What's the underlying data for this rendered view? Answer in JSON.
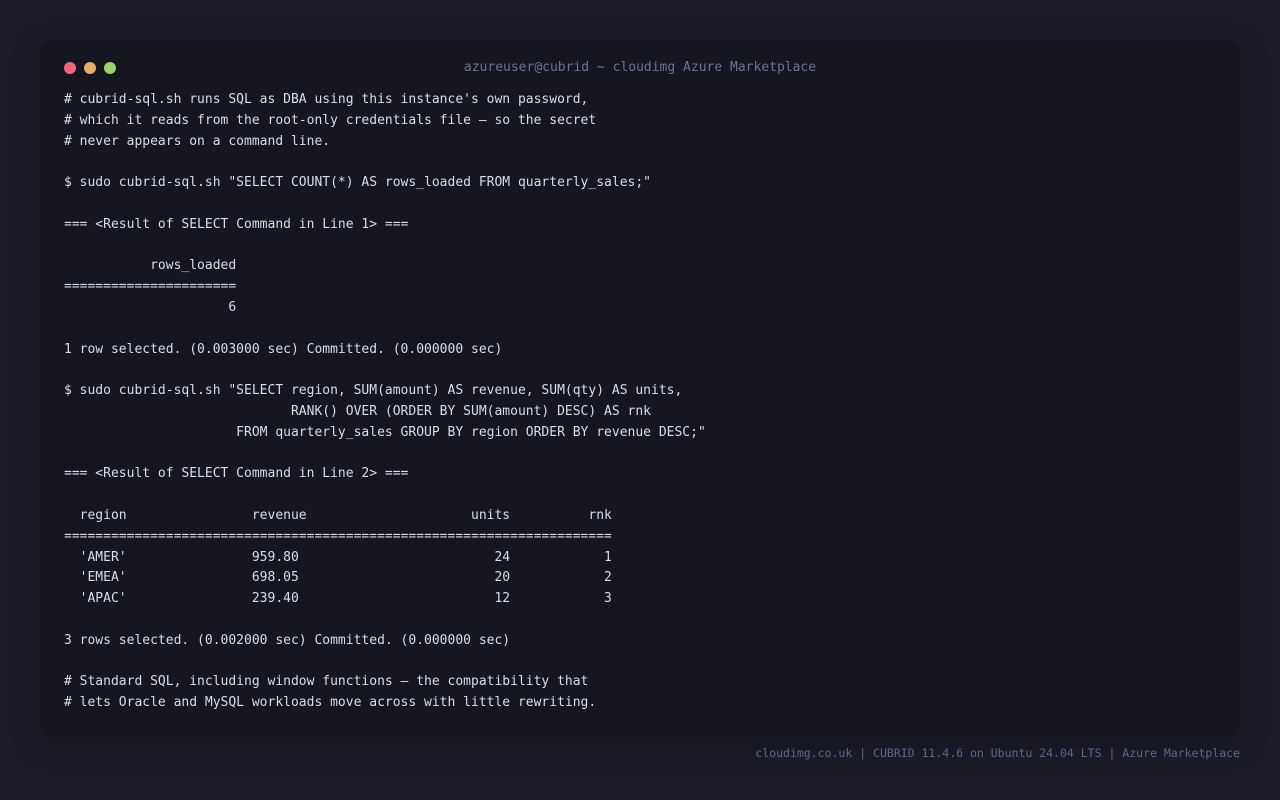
{
  "window": {
    "title": "azureuser@cubrid ~ cloudimg Azure Marketplace",
    "traffic_lights": {
      "close": "#f0677d",
      "minimize": "#e6ad6b",
      "maximize": "#9ad26d"
    }
  },
  "terminal": {
    "lines": [
      "# cubrid-sql.sh runs SQL as DBA using this instance's own password,",
      "# which it reads from the root-only credentials file — so the secret",
      "# never appears on a command line.",
      "",
      "$ sudo cubrid-sql.sh \"SELECT COUNT(*) AS rows_loaded FROM quarterly_sales;\"",
      "",
      "=== <Result of SELECT Command in Line 1> ===",
      "",
      "           rows_loaded",
      "======================",
      "                     6",
      "",
      "1 row selected. (0.003000 sec) Committed. (0.000000 sec)",
      "",
      "$ sudo cubrid-sql.sh \"SELECT region, SUM(amount) AS revenue, SUM(qty) AS units,",
      "                             RANK() OVER (ORDER BY SUM(amount) DESC) AS rnk",
      "                      FROM quarterly_sales GROUP BY region ORDER BY revenue DESC;\"",
      "",
      "=== <Result of SELECT Command in Line 2> ===",
      "",
      "  region                revenue                     units          rnk",
      "======================================================================",
      "  'AMER'                959.80                         24            1",
      "  'EMEA'                698.05                         20            2",
      "  'APAC'                239.40                         12            3",
      "",
      "3 rows selected. (0.002000 sec) Committed. (0.000000 sec)",
      "",
      "# Standard SQL, including window functions — the compatibility that",
      "# lets Oracle and MySQL workloads move across with little rewriting."
    ]
  },
  "footer": {
    "text": "cloudimg.co.uk | CUBRID 11.4.6 on Ubuntu 24.04 LTS | Azure Marketplace"
  }
}
